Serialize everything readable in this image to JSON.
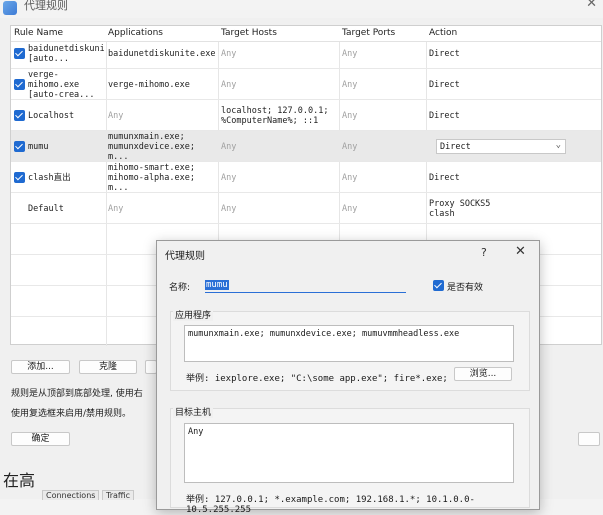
{
  "window": {
    "title": "代理规则"
  },
  "table": {
    "headers": [
      "Rule Name",
      "Applications",
      "Target Hosts",
      "Target Ports",
      "Action"
    ],
    "rows": [
      {
        "name": "baidunetdiskunite.exe [auto...",
        "apps": "baidunetdiskunite.exe",
        "hosts": "Any",
        "ports": "Any",
        "action": "Direct"
      },
      {
        "name": "verge-mihomo.exe [auto-crea...",
        "apps": "verge-mihomo.exe",
        "hosts": "Any",
        "ports": "Any",
        "action": "Direct"
      },
      {
        "name": "Localhost",
        "apps": "Any",
        "hosts": "localhost; 127.0.0.1; %ComputerName%; ::1",
        "ports": "Any",
        "action": "Direct"
      },
      {
        "name": "mumu",
        "apps": "mumunxmain.exe; mumunxdevice.exe; m...",
        "hosts": "Any",
        "ports": "Any",
        "action": "Direct"
      },
      {
        "name": "clash直出",
        "apps": "mihomo-smart.exe; mihomo-alpha.exe; m...",
        "hosts": "Any",
        "ports": "Any",
        "action": "Direct"
      },
      {
        "name": "Default",
        "apps": "Any",
        "hosts": "Any",
        "ports": "Any",
        "action": "Proxy SOCKS5 clash"
      }
    ]
  },
  "buttons": {
    "add": "添加...",
    "delete": "克隆",
    "ok": "确定"
  },
  "info": {
    "line1": "规则是从顶部到底部处理, 使用右",
    "line2": "使用复选框来启用/禁用规则。"
  },
  "background": {
    "text": "在高",
    "tabs": [
      "Connections",
      "Traffic"
    ]
  },
  "dialog": {
    "title": "代理规则",
    "help": "?",
    "close": "✕",
    "name_label": "名称:",
    "name_value": "mumu",
    "enabled_label": "是否有效",
    "apps_section": "应用程序",
    "apps_value": "mumunxmain.exe; mumunxdevice.exe; mumuvmmheadless.exe",
    "apps_example": "举例: iexplore.exe; \"C:\\some app.exe\"; fire*.exe; *.bin",
    "browse_button": "浏览...",
    "hosts_section": "目标主机",
    "hosts_value": "Any",
    "hosts_example": "举例: 127.0.0.1; *.example.com; 192.168.1.*; 10.1.0.0-10.5.255.255"
  }
}
